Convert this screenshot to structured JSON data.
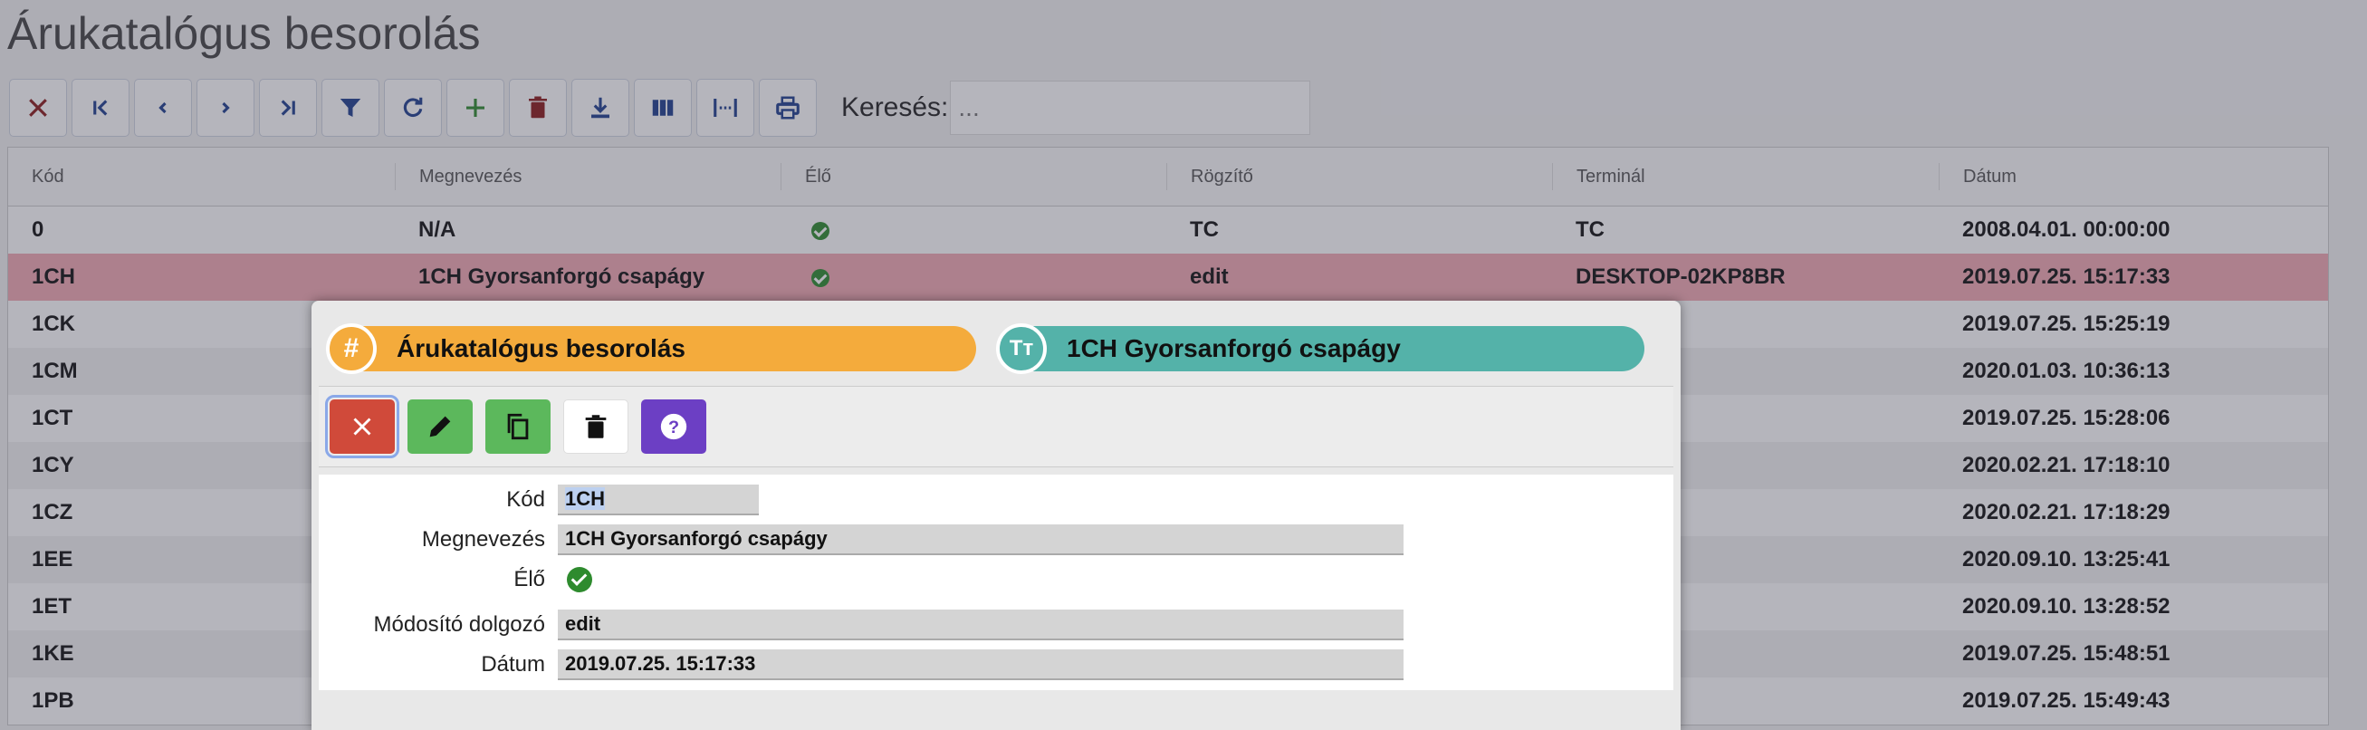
{
  "page": {
    "title": "Árukatalógus besorolás"
  },
  "toolbar": {
    "buttons": [
      {
        "name": "close-icon",
        "color": "#8b1a1a"
      },
      {
        "name": "first-page-icon",
        "color": "#1f3f8f"
      },
      {
        "name": "previous-icon",
        "color": "#1f3f8f"
      },
      {
        "name": "next-icon",
        "color": "#1f3f8f"
      },
      {
        "name": "last-page-icon",
        "color": "#1f3f8f"
      },
      {
        "name": "filter-icon",
        "color": "#1f3f8f"
      },
      {
        "name": "refresh-icon",
        "color": "#1f3f8f"
      },
      {
        "name": "add-icon",
        "color": "#2e8b2e"
      },
      {
        "name": "delete-icon",
        "color": "#8b1a1a"
      },
      {
        "name": "download-icon",
        "color": "#1f3f8f"
      },
      {
        "name": "columns-icon",
        "color": "#1f3f8f"
      },
      {
        "name": "fit-width-icon",
        "color": "#1f3f8f"
      },
      {
        "name": "print-icon",
        "color": "#1f3f8f"
      }
    ],
    "search_label": "Keresés:",
    "search_placeholder": "..."
  },
  "grid": {
    "headers": [
      "Kód",
      "Megnevezés",
      "Élő",
      "Rögzítő",
      "Terminál",
      "Dátum"
    ],
    "rows": [
      {
        "kod": "0",
        "nev": "N/A",
        "elo": true,
        "rogzito": "TC",
        "terminal": "TC",
        "datum": "2008.04.01. 00:00:00"
      },
      {
        "kod": "1CH",
        "nev": "1CH Gyorsanforgó csapágy",
        "elo": true,
        "rogzito": "edit",
        "terminal": "DESKTOP-02KP8BR",
        "datum": "2019.07.25. 15:17:33",
        "selected": true
      },
      {
        "kod": "1CK",
        "nev": "",
        "elo": false,
        "rogzito": "",
        "terminal": "-02KP8BR",
        "datum": "2019.07.25. 15:25:19"
      },
      {
        "kod": "1CM",
        "nev": "",
        "elo": false,
        "rogzito": "",
        "terminal": "",
        "datum": "2020.01.03. 10:36:13"
      },
      {
        "kod": "1CT",
        "nev": "",
        "elo": false,
        "rogzito": "",
        "terminal": "-02KP8BR",
        "datum": "2019.07.25. 15:28:06"
      },
      {
        "kod": "1CY",
        "nev": "",
        "elo": false,
        "rogzito": "",
        "terminal": "",
        "datum": "2020.02.21. 17:18:10"
      },
      {
        "kod": "1CZ",
        "nev": "",
        "elo": false,
        "rogzito": "",
        "terminal": "",
        "datum": "2020.02.21. 17:18:29"
      },
      {
        "kod": "1EE",
        "nev": "",
        "elo": false,
        "rogzito": "",
        "terminal": "",
        "datum": "2020.09.10. 13:25:41"
      },
      {
        "kod": "1ET",
        "nev": "",
        "elo": false,
        "rogzito": "",
        "terminal": "",
        "datum": "2020.09.10. 13:28:52"
      },
      {
        "kod": "1KE",
        "nev": "",
        "elo": false,
        "rogzito": "",
        "terminal": "-02KP8BR",
        "datum": "2019.07.25. 15:48:51"
      },
      {
        "kod": "1PB",
        "nev": "",
        "elo": false,
        "rogzito": "",
        "terminal": "-02KP8BR",
        "datum": "2019.07.25. 15:49:43"
      }
    ]
  },
  "dialog": {
    "left_title": "Árukatalógus besorolás",
    "right_title": "1CH Gyorsanforgó csapágy",
    "form": {
      "kod_label": "Kód",
      "kod_value": "1CH",
      "nev_label": "Megnevezés",
      "nev_value": "1CH Gyorsanforgó csapágy",
      "elo_label": "Élő",
      "mod_label": "Módosító dolgozó",
      "mod_value": "edit",
      "datum_label": "Dátum",
      "datum_value": "2019.07.25. 15:17:33"
    }
  }
}
